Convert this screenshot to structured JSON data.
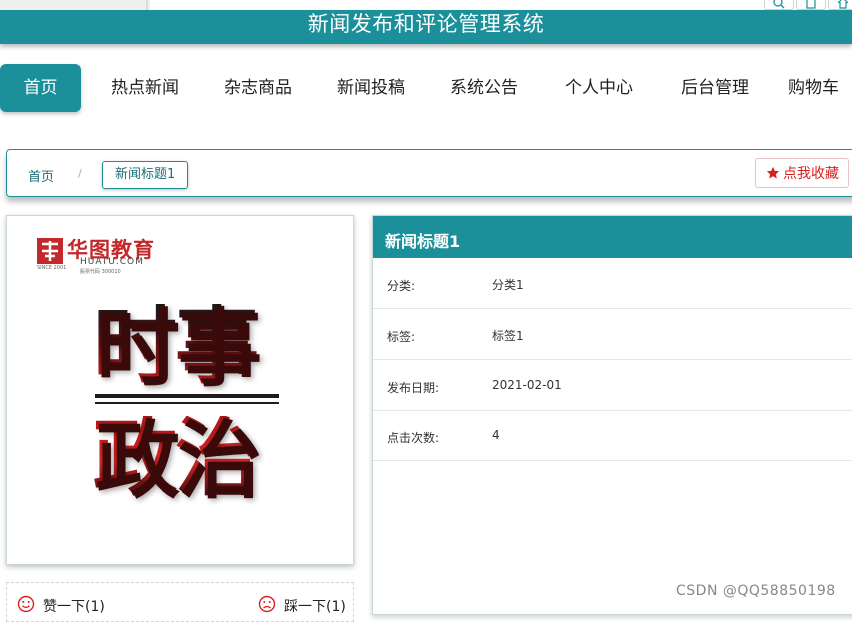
{
  "header": {
    "title": "新闻发布和评论管理系统"
  },
  "nav": [
    {
      "label": "首页",
      "active": true
    },
    {
      "label": "热点新闻"
    },
    {
      "label": "杂志商品"
    },
    {
      "label": "新闻投稿"
    },
    {
      "label": "系统公告"
    },
    {
      "label": "个人中心"
    },
    {
      "label": "后台管理"
    },
    {
      "label": "购物车"
    }
  ],
  "breadcrumb": {
    "home": "首页",
    "separator": "/",
    "current": "新闻标题1"
  },
  "favorite_button": {
    "label": "点我收藏",
    "icon": "star-icon"
  },
  "image": {
    "logo_text": "华图教育",
    "logo_sub": "HUATU.COM",
    "logo_tiny_left": "SINCE 2001",
    "logo_tiny_right": "股票代码 300010",
    "line1": "时事",
    "line2": "政治"
  },
  "votes": {
    "like_label": "赞一下(1)",
    "dislike_label": "踩一下(1)"
  },
  "detail": {
    "title": "新闻标题1",
    "rows": [
      {
        "key": "分类:",
        "value": "分类1"
      },
      {
        "key": "标签:",
        "value": "标签1"
      },
      {
        "key": "发布日期:",
        "value": "2021-02-01"
      },
      {
        "key": "点击次数:",
        "value": "4"
      }
    ]
  },
  "watermark": "CSDN @QQ58850198",
  "colors": {
    "primary": "#1b8f9a",
    "accent_red": "#d9201e"
  }
}
